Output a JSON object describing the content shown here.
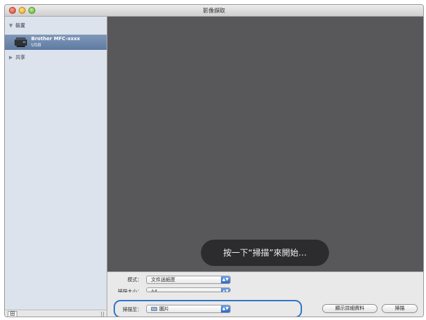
{
  "window": {
    "title": "影像擷取"
  },
  "sidebar": {
    "section_devices": "裝置",
    "section_shared": "共享",
    "device": {
      "name": "Brother MFC-xxxx",
      "sub": "USB"
    },
    "bottom_button": "田"
  },
  "preview": {
    "hud_text": "按一下“掃描”來開始…"
  },
  "controls": {
    "mode_label": "模式：",
    "mode_value": "文件送紙匣",
    "size_label": "掃描大小：",
    "size_value": "A4",
    "scan_to_label": "掃描至：",
    "scan_to_value": "圖片",
    "show_details_button": "顯示詳細資料",
    "scan_button": "掃描"
  },
  "colors": {
    "preview_bg": "#58585a",
    "sidebar_bg": "#dce3ec",
    "selection": "#6f89ad",
    "highlight_ring": "#2f76c7"
  }
}
